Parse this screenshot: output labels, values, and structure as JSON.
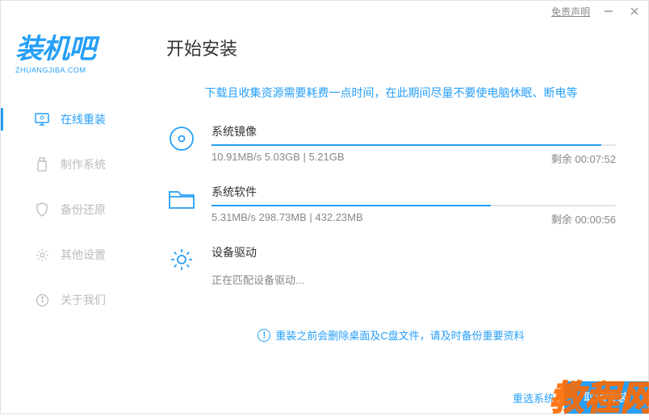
{
  "titlebar": {
    "disclaimer": "免责声明"
  },
  "logo": {
    "main": "装机吧",
    "sub": "ZHUANGJIBA.COM"
  },
  "sidebar": {
    "items": [
      {
        "label": "在线重装",
        "active": true
      },
      {
        "label": "制作系统",
        "active": false
      },
      {
        "label": "备份还原",
        "active": false
      },
      {
        "label": "其他设置",
        "active": false
      },
      {
        "label": "关于我们",
        "active": false
      }
    ]
  },
  "page": {
    "title": "开始安装",
    "notice": "下载且收集资源需要耗费一点时间，在此期间尽量不要使电脑休眠、断电等"
  },
  "downloads": {
    "image": {
      "title": "系统镜像",
      "speed": "10.91MB/s",
      "done": "5.03GB",
      "total": "5.21GB",
      "stats": "10.91MB/s 5.03GB | 5.21GB",
      "remaining_label": "剩余",
      "remaining_time": "00:07:52",
      "progress_pct": 96.5
    },
    "software": {
      "title": "系统软件",
      "speed": "5.31MB/s",
      "done": "298.73MB",
      "total": "432.23MB",
      "stats": "5.31MB/s 298.73MB | 432.23MB",
      "remaining_label": "剩余",
      "remaining_time": "00:00:56",
      "progress_pct": 69.1
    },
    "drivers": {
      "title": "设备驱动",
      "status": "正在匹配设备驱动..."
    }
  },
  "warning": {
    "text": "重装之前会删除桌面及C盘文件，请及时备份重要资料"
  },
  "footer": {
    "reselect": "重选系统",
    "confirm": "取消安装"
  },
  "watermark": "教程网"
}
